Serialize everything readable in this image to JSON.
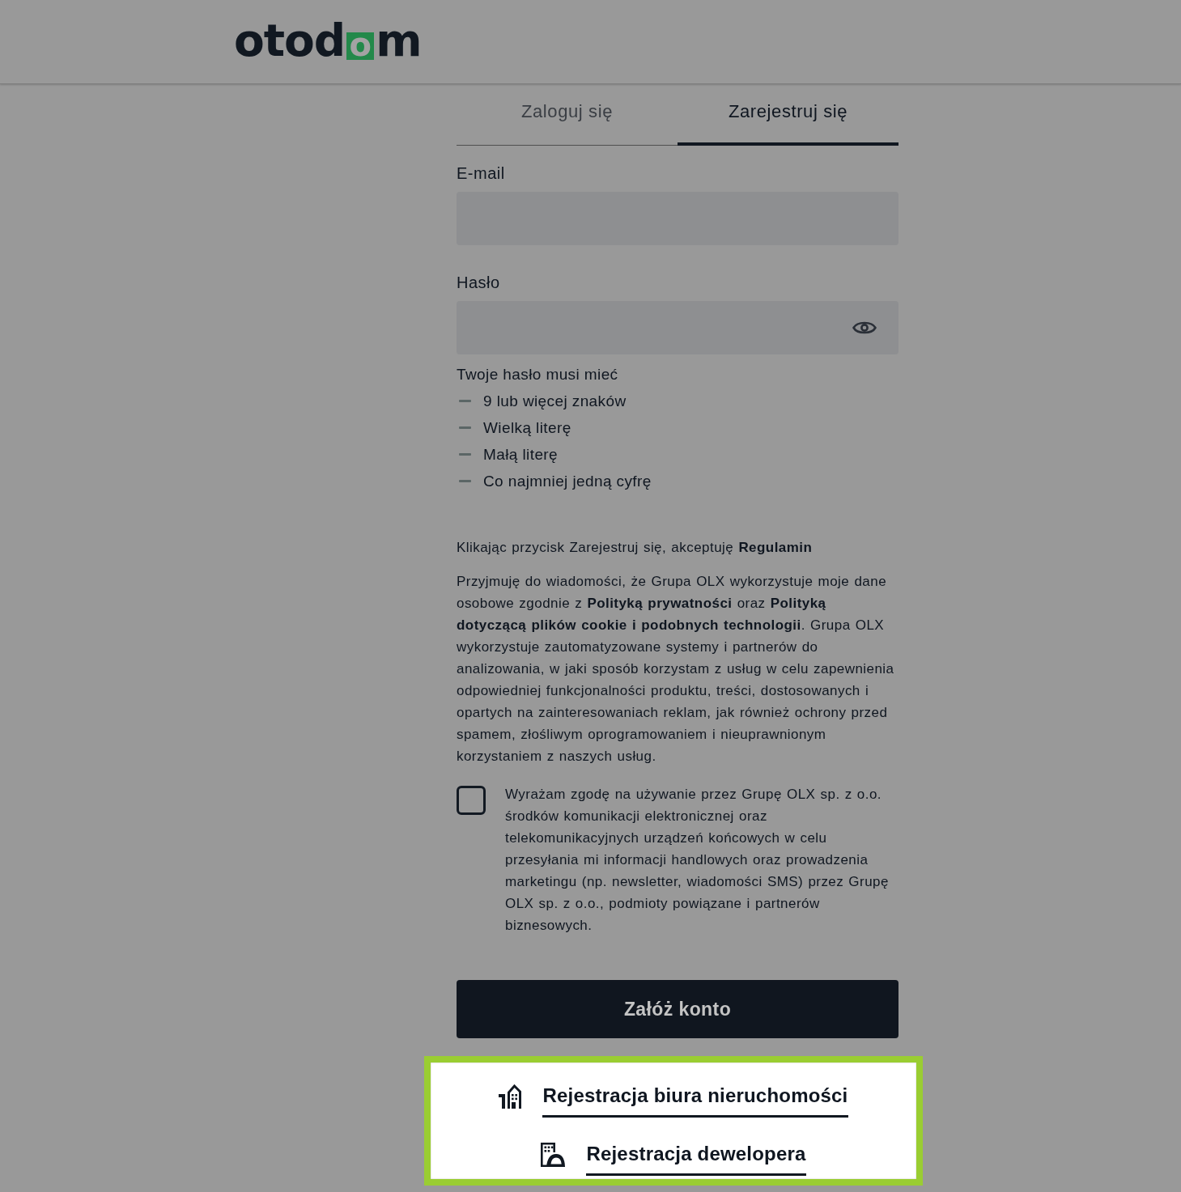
{
  "header": {
    "logo": {
      "text_before": "otod",
      "mark_letter": "o",
      "text_after": "m"
    }
  },
  "tabs": [
    {
      "label": "Zaloguj się",
      "selected": false
    },
    {
      "label": "Zarejestruj się",
      "selected": true
    }
  ],
  "fields": [
    {
      "kind": "email",
      "label": "E-mail"
    },
    {
      "kind": "password",
      "label": "Hasło"
    }
  ],
  "password_rules": {
    "title": "Twoje hasło musi mieć",
    "items": [
      {
        "text": "9 lub więcej znaków",
        "met": false
      },
      {
        "text": "Wielką literę",
        "met": false
      },
      {
        "text": "Małą literę",
        "met": false
      },
      {
        "text": "Co najmniej jedną cyfrę",
        "met": false
      }
    ]
  },
  "terms": "Klikając przycisk Zarejestruj się, akceptuję **Regulamin**",
  "privacy_notice": "Przyjmuję do wiadomości, że Grupa OLX wykorzystuje moje dane osobowe zgodnie z **Polityką prywatności** oraz **Polityką dotyczącą plików cookie i podobnych technologii**. Grupa OLX wykorzystuje zautomatyzowane systemy i partnerów do analizowania, w jaki sposób korzystam z usług w celu zapewnienia odpowiedniej funkcjonalności produktu, treści, dostosowanych i opartych na zainteresowaniach reklam, jak również ochrony przed spamem, złośliwym oprogramowaniem i nieuprawnionym korzystaniem z naszych usług.",
  "consent": {
    "checked": false,
    "text": "Wyrażam zgodę na używanie przez Grupę OLX sp. z o.o. środków komunikacji elektronicznej oraz telekomunikacyjnych urządzeń końcowych w celu przesyłania mi informacji handlowych oraz prowadzenia marketingu (np. newsletter, wiadomości SMS) przez Grupę OLX sp. z o.o., podmioty powiązane i partnerów biznesowych."
  },
  "submit_button": "Załóż konto",
  "business_links": [
    {
      "kind": "agency",
      "label": "Rejestracja biura nieruchomości"
    },
    {
      "kind": "developer",
      "label": "Rejestracja dewelopera"
    }
  ]
}
